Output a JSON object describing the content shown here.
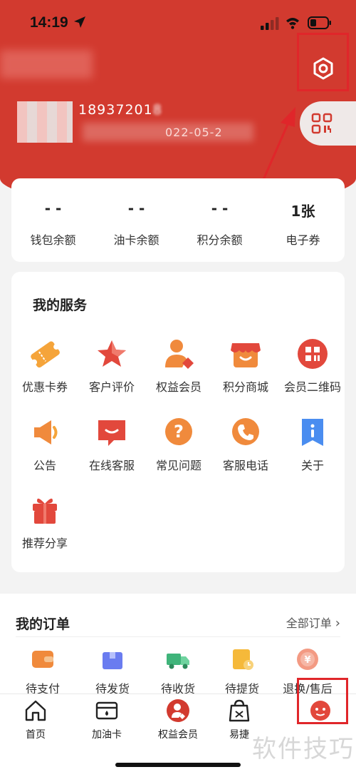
{
  "status_bar": {
    "time": "14:19"
  },
  "profile": {
    "phone": "18937201",
    "phone_tail": "8",
    "date": "022-05-2"
  },
  "stats": [
    {
      "value": "- -",
      "label": "钱包余额"
    },
    {
      "value": "- -",
      "label": "油卡余额"
    },
    {
      "value": "- -",
      "label": "积分余额"
    },
    {
      "value": "1张",
      "label": "电子券"
    }
  ],
  "services": {
    "title": "我的服务",
    "items": [
      {
        "label": "优惠卡券",
        "icon": "ticket-icon"
      },
      {
        "label": "客户评价",
        "icon": "star-icon"
      },
      {
        "label": "权益会员",
        "icon": "member-icon"
      },
      {
        "label": "积分商城",
        "icon": "shop-icon"
      },
      {
        "label": "会员二维码",
        "icon": "qrcode-icon"
      },
      {
        "label": "公告",
        "icon": "megaphone-icon"
      },
      {
        "label": "在线客服",
        "icon": "chat-icon"
      },
      {
        "label": "常见问题",
        "icon": "question-icon"
      },
      {
        "label": "客服电话",
        "icon": "phone-icon"
      },
      {
        "label": "关于",
        "icon": "info-icon"
      },
      {
        "label": "推荐分享",
        "icon": "gift-icon"
      }
    ]
  },
  "orders": {
    "title": "我的订单",
    "all_label": "全部订单",
    "items": [
      {
        "label": "待支付",
        "icon": "wallet-icon"
      },
      {
        "label": "待发货",
        "icon": "box-icon"
      },
      {
        "label": "待收货",
        "icon": "truck-icon"
      },
      {
        "label": "待提货",
        "icon": "pickup-icon"
      },
      {
        "label": "退换/售后",
        "icon": "refund-icon"
      }
    ]
  },
  "tabs": [
    {
      "label": "首页",
      "icon": "home-icon"
    },
    {
      "label": "加油卡",
      "icon": "card-icon"
    },
    {
      "label": "权益会员",
      "icon": "member-icon"
    },
    {
      "label": "易捷",
      "icon": "bag-icon"
    },
    {
      "label": "",
      "icon": "profile-icon"
    }
  ],
  "watermark": "软件技巧",
  "colors": {
    "brand_red": "#d23a2f",
    "annotation_red": "#e0262a",
    "accent_orange": "#f08a3c"
  }
}
